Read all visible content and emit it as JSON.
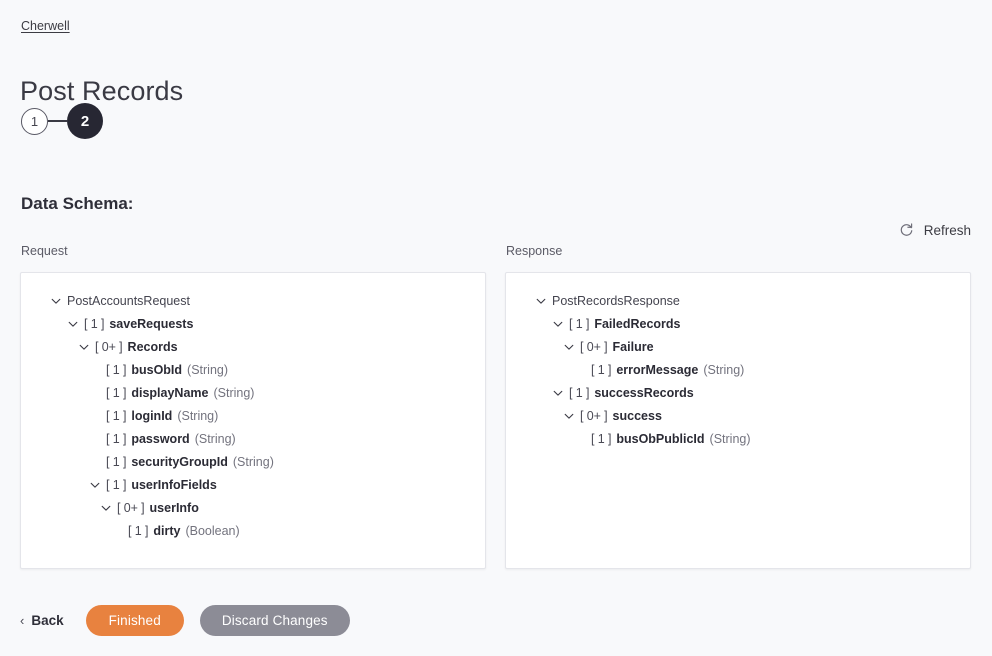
{
  "breadcrumb": {
    "label": "Cherwell"
  },
  "page": {
    "title": "Post Records",
    "section_heading": "Data Schema:"
  },
  "steps": [
    {
      "label": "1",
      "state": "inactive"
    },
    {
      "label": "2",
      "state": "active"
    }
  ],
  "toolbar": {
    "refresh_label": "Refresh",
    "refresh_icon": "refresh-icon"
  },
  "panels": {
    "request": {
      "label": "Request",
      "tree": [
        {
          "level": 0,
          "chevron": "chevron-down-icon",
          "cardinality": "",
          "name": "PostAccountsRequest",
          "type": "",
          "root": true
        },
        {
          "level": 1,
          "chevron": "chevron-down-icon",
          "cardinality": "[ 1 ]",
          "name": "saveRequests",
          "type": ""
        },
        {
          "level": 2,
          "chevron": "chevron-down-icon",
          "cardinality": "[ 0+ ]",
          "name": "Records",
          "type": ""
        },
        {
          "level": 3,
          "chevron": "",
          "cardinality": "[ 1 ]",
          "name": "busObId",
          "type": "(String)"
        },
        {
          "level": 3,
          "chevron": "",
          "cardinality": "[ 1 ]",
          "name": "displayName",
          "type": "(String)"
        },
        {
          "level": 3,
          "chevron": "",
          "cardinality": "[ 1 ]",
          "name": "loginId",
          "type": "(String)"
        },
        {
          "level": 3,
          "chevron": "",
          "cardinality": "[ 1 ]",
          "name": "password",
          "type": "(String)"
        },
        {
          "level": 3,
          "chevron": "",
          "cardinality": "[ 1 ]",
          "name": "securityGroupId",
          "type": "(String)"
        },
        {
          "level": 3,
          "chevron": "chevron-down-icon",
          "cardinality": "[ 1 ]",
          "name": "userInfoFields",
          "type": ""
        },
        {
          "level": 4,
          "chevron": "chevron-down-icon",
          "cardinality": "[ 0+ ]",
          "name": "userInfo",
          "type": ""
        },
        {
          "level": 5,
          "chevron": "",
          "cardinality": "[ 1 ]",
          "name": "dirty",
          "type": "(Boolean)"
        }
      ]
    },
    "response": {
      "label": "Response",
      "tree": [
        {
          "level": 0,
          "chevron": "chevron-down-icon",
          "cardinality": "",
          "name": "PostRecordsResponse",
          "type": "",
          "root": true
        },
        {
          "level": 1,
          "chevron": "chevron-down-icon",
          "cardinality": "[ 1 ]",
          "name": "FailedRecords",
          "type": ""
        },
        {
          "level": 2,
          "chevron": "chevron-down-icon",
          "cardinality": "[ 0+ ]",
          "name": "Failure",
          "type": ""
        },
        {
          "level": 3,
          "chevron": "",
          "cardinality": "[ 1 ]",
          "name": "errorMessage",
          "type": "(String)"
        },
        {
          "level": 1,
          "chevron": "chevron-down-icon",
          "cardinality": "[ 1 ]",
          "name": "successRecords",
          "type": ""
        },
        {
          "level": 2,
          "chevron": "chevron-down-icon",
          "cardinality": "[ 0+ ]",
          "name": "success",
          "type": ""
        },
        {
          "level": 3,
          "chevron": "",
          "cardinality": "[ 1 ]",
          "name": "busObPublicId",
          "type": "(String)"
        }
      ]
    }
  },
  "footer": {
    "back_label": "Back",
    "back_chevron": "chevron-left-icon",
    "finished_label": "Finished",
    "discard_label": "Discard Changes"
  },
  "colors": {
    "page_background": "#f8f9fb",
    "panel_background": "#ffffff",
    "primary_button": "#e8823f",
    "secondary_button": "#8c8c96",
    "active_step": "#272733"
  }
}
